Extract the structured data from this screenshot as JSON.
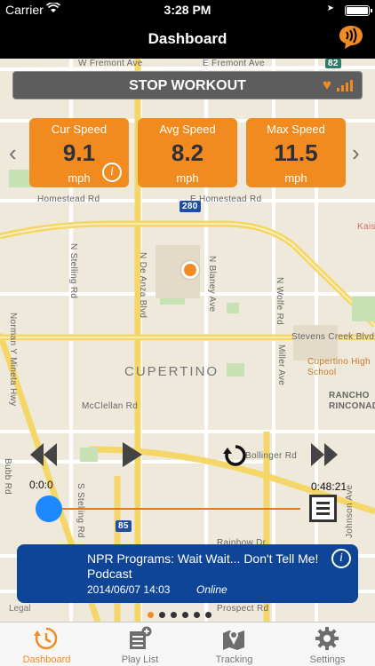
{
  "status_bar": {
    "carrier": "Carrier",
    "time": "3:28 PM"
  },
  "nav": {
    "title": "Dashboard",
    "icon": "chat-bubble-icon"
  },
  "map": {
    "streets": [
      "W Fremont Ave",
      "E Fremont Ave",
      "Homestead Rd",
      "E Homestead Rd",
      "N Stelling Rd",
      "N De Anza Blvd",
      "N Blaney Ave",
      "N Wolfe Rd",
      "Norman Y Mineta Hwy",
      "Stevens Creek Blvd",
      "McClellan Rd",
      "S Stelling Rd",
      "Bubb Rd",
      "Miller Ave",
      "Johnson Ave",
      "Rainbow Dr",
      "Prospect Rd",
      "Bollinger Rd"
    ],
    "city": "CUPERTINO",
    "places": [
      "Cupertino High School",
      "RANCHO RINCONADA",
      "Kaiser Permanente"
    ],
    "route_shields": [
      "82",
      "280",
      "85"
    ],
    "legal": "Legal"
  },
  "workout": {
    "stop_label": "STOP WORKOUT",
    "accent": "#f18a1f"
  },
  "speeds": [
    {
      "label": "Cur Speed",
      "value": "9.1",
      "unit": "mph"
    },
    {
      "label": "Avg Speed",
      "value": "8.2",
      "unit": "mph"
    },
    {
      "label": "Max Speed",
      "value": "11.5",
      "unit": "mph"
    }
  ],
  "player": {
    "elapsed": "0:0:0",
    "duration": "0:48:21",
    "progress": 0.0
  },
  "podcast": {
    "title": "NPR Programs: Wait Wait... Don't Tell Me! Podcast",
    "date": "2014/06/07 14:03",
    "status": "Online",
    "bg": "#0f4596"
  },
  "page_dots": {
    "count": 6,
    "active": 0
  },
  "tabs": [
    {
      "label": "Dashboard",
      "icon": "dashboard-clock-icon",
      "active": true
    },
    {
      "label": "Play List",
      "icon": "playlist-add-icon",
      "active": false
    },
    {
      "label": "Tracking",
      "icon": "map-pin-icon",
      "active": false
    },
    {
      "label": "Settings",
      "icon": "gear-icon",
      "active": false
    }
  ]
}
